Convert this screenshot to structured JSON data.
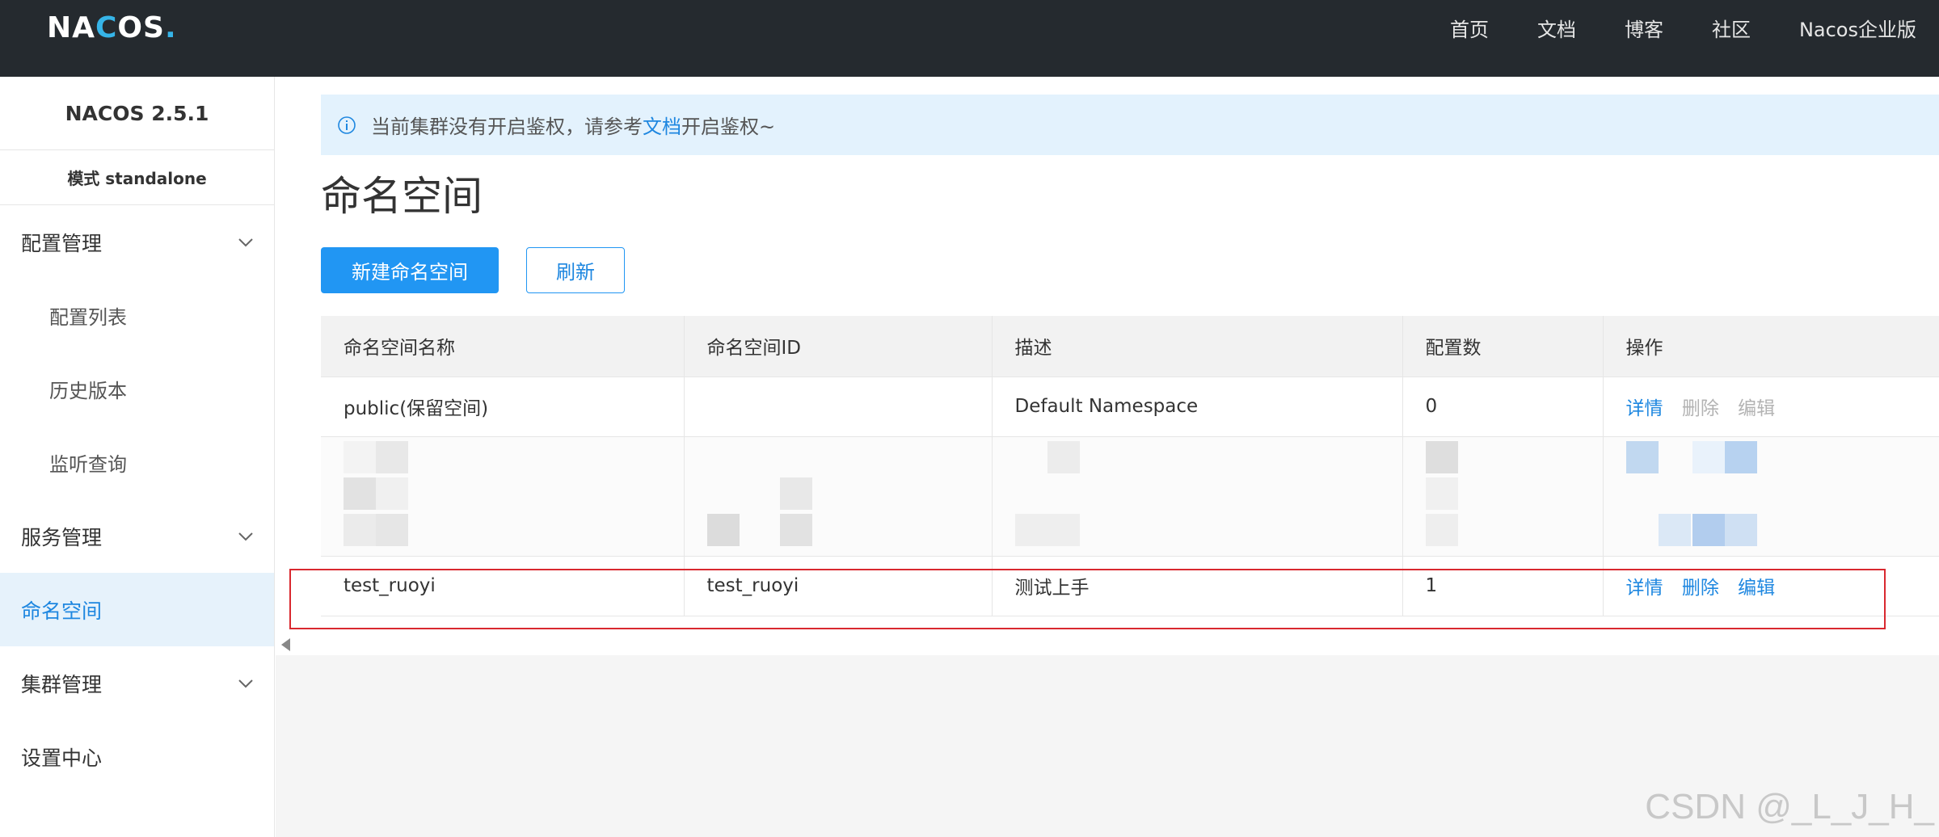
{
  "header": {
    "logo_prefix": "NA",
    "logo_mid": "C",
    "logo_rest": "OS",
    "logo_dot": ".",
    "nav": [
      "首页",
      "文档",
      "博客",
      "社区",
      "Nacos企业版"
    ]
  },
  "sidebar": {
    "version": "NACOS 2.5.1",
    "mode": "模式 standalone",
    "items": [
      {
        "label": "配置管理",
        "type": "group"
      },
      {
        "label": "配置列表",
        "type": "sub"
      },
      {
        "label": "历史版本",
        "type": "sub"
      },
      {
        "label": "监听查询",
        "type": "sub"
      },
      {
        "label": "服务管理",
        "type": "group"
      },
      {
        "label": "命名空间",
        "type": "active"
      },
      {
        "label": "集群管理",
        "type": "group"
      },
      {
        "label": "设置中心",
        "type": "item"
      }
    ]
  },
  "notice": {
    "before": "当前集群没有开启鉴权，请参考",
    "link": "文档",
    "after": "开启鉴权~"
  },
  "page": {
    "title": "命名空间",
    "create_button": "新建命名空间",
    "refresh_button": "刷新"
  },
  "table": {
    "columns": [
      "命名空间名称",
      "命名空间ID",
      "描述",
      "配置数",
      "操作"
    ],
    "rows": [
      {
        "name": "public(保留空间)",
        "id": "",
        "desc": "Default Namespace",
        "count": "0",
        "actions": [
          "详情",
          "删除",
          "编辑"
        ],
        "enabled": [
          true,
          false,
          false
        ]
      },
      {
        "name": "test_ruoyi",
        "id": "test_ruoyi",
        "desc": "测试上手",
        "count": "1",
        "actions": [
          "详情",
          "删除",
          "编辑"
        ],
        "enabled": [
          true,
          true,
          true
        ]
      }
    ]
  },
  "colors": {
    "topbar": "#252a2f",
    "primary": "#2196f3",
    "link": "#1e87e0",
    "highlight": "#d9282f"
  },
  "watermark": "CSDN @_L_J_H_"
}
